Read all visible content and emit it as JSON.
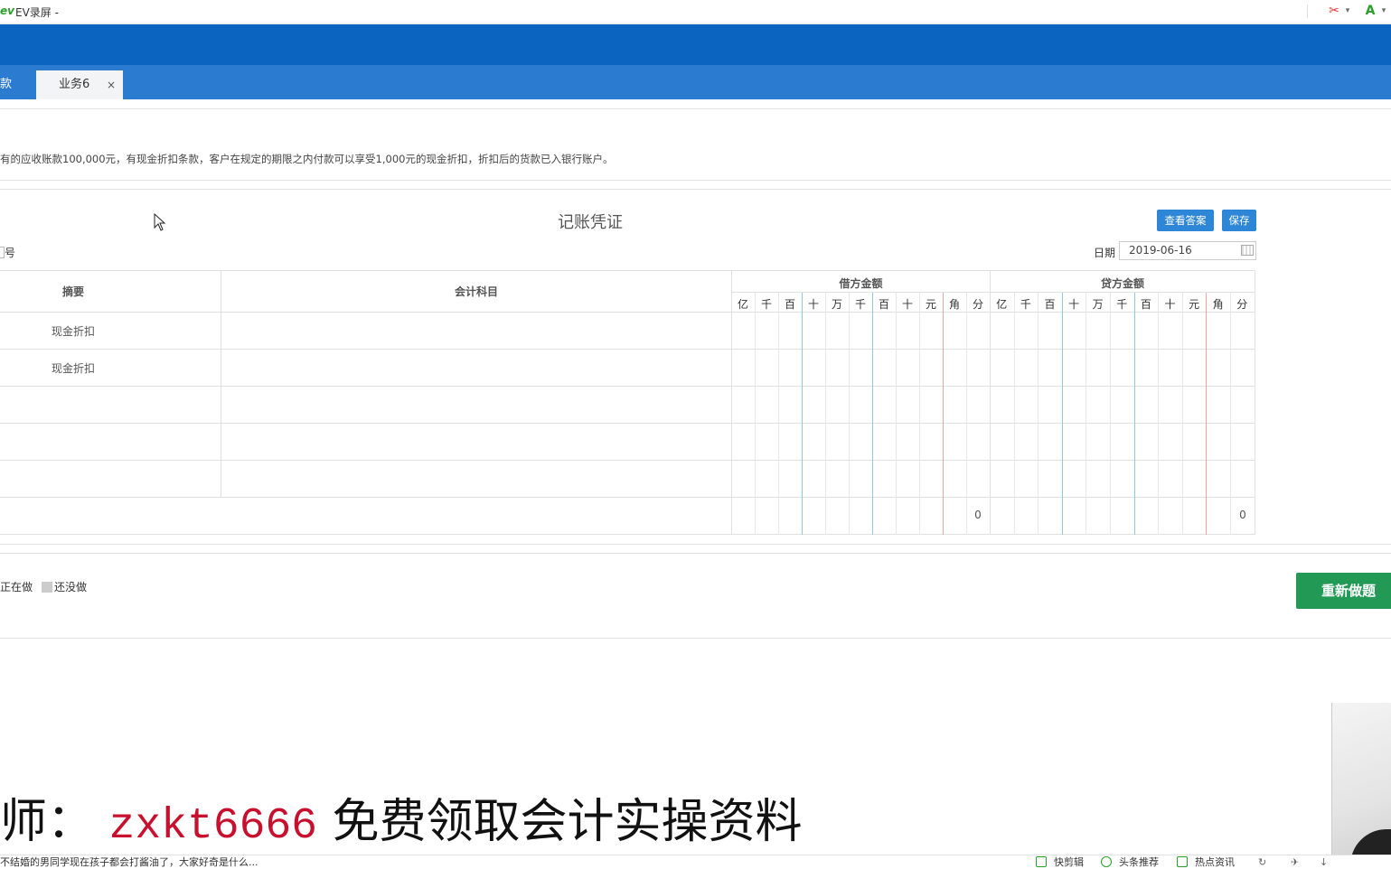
{
  "titlebar": {
    "logo": "ev",
    "title": "EV录屏 -",
    "icons": [
      "scissors-icon",
      "dropdown-icon",
      "translate-icon",
      "dropdown-icon"
    ]
  },
  "tabs": [
    {
      "label": "款"
    },
    {
      "label": "业务6",
      "close": "×"
    }
  ],
  "description": "有的应收账款100,000元，有现金折扣条款，客户在规定的期限之内付款可以享受1,000元的现金折扣，折扣后的货款已入银行账户。",
  "voucher": {
    "title": "记账凭证",
    "answer_button": "查看答案",
    "save_button": "保存",
    "number_label": "号",
    "date_label": "日期",
    "date_value": "2019-06-16",
    "columns": {
      "summary": "摘要",
      "account": "会计科目",
      "debit": "借方金额",
      "credit": "贷方金额",
      "digits": [
        "亿",
        "千",
        "百",
        "十",
        "万",
        "千",
        "百",
        "十",
        "元",
        "角",
        "分"
      ]
    },
    "rows": [
      {
        "summary": "现金折扣",
        "account": ""
      },
      {
        "summary": "现金折扣",
        "account": ""
      },
      {
        "summary": "",
        "account": ""
      },
      {
        "summary": "",
        "account": ""
      },
      {
        "summary": "",
        "account": ""
      }
    ],
    "total": {
      "debit": "0",
      "credit": "0"
    }
  },
  "status": {
    "doing": "正在做",
    "not_done": "还没做"
  },
  "redo_button": "重新做题",
  "promo": {
    "prefix": "师：",
    "code": "zxkt6666",
    "text": "免费领取会计实操资料"
  },
  "statusbar": {
    "news": "不结婚的男同学现在孩子都会打酱油了，大家好奇是什么...",
    "items": [
      "快剪辑",
      "头条推荐",
      "热点资讯"
    ]
  },
  "colors": {
    "brand_blue": "#0a64c0",
    "tab_blue": "#2b7bd0",
    "button_blue": "#2e86d6",
    "redo_green": "#229a56",
    "promo_red": "#c8102e",
    "separator_blue": "#8ec9ee",
    "separator_red": "#f2a3a3"
  }
}
